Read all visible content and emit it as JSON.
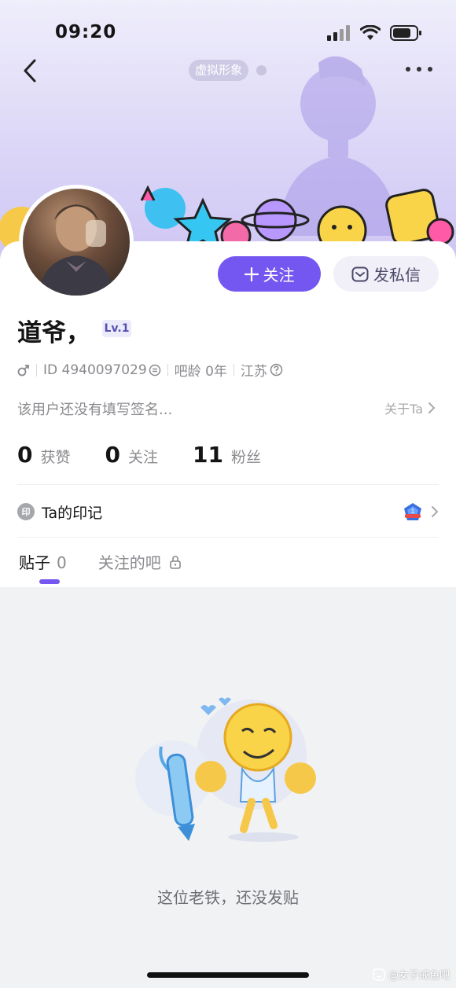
{
  "status_bar": {
    "time": "09:20"
  },
  "header": {
    "avatar_tag": "虚拟形象"
  },
  "actions": {
    "follow_label": "关注",
    "message_label": "发私信"
  },
  "profile": {
    "nickname": "道爷，",
    "level": "Lv.1",
    "id_text": "ID 4940097029",
    "age_text": "吧龄 0年",
    "region": "江苏",
    "signature": "该用户还没有填写签名...",
    "about_label": "关于Ta"
  },
  "stats": [
    {
      "value": "0",
      "label": "获赞"
    },
    {
      "value": "0",
      "label": "关注"
    },
    {
      "value": "11",
      "label": "粉丝"
    }
  ],
  "mark": {
    "icon_text": "印",
    "label": "Ta的印记",
    "badge_icon": "medal-icon"
  },
  "tabs": {
    "posts_label": "贴子",
    "posts_count": "0",
    "followed_bars_label": "关注的吧"
  },
  "empty_state": {
    "text": "这位老铁，还没发贴"
  },
  "watermark": {
    "text": "@女子戒色吧"
  },
  "colors": {
    "accent": "#7457f0",
    "banner_top": "#efeefb",
    "banner_bottom": "#cfc6f4"
  }
}
